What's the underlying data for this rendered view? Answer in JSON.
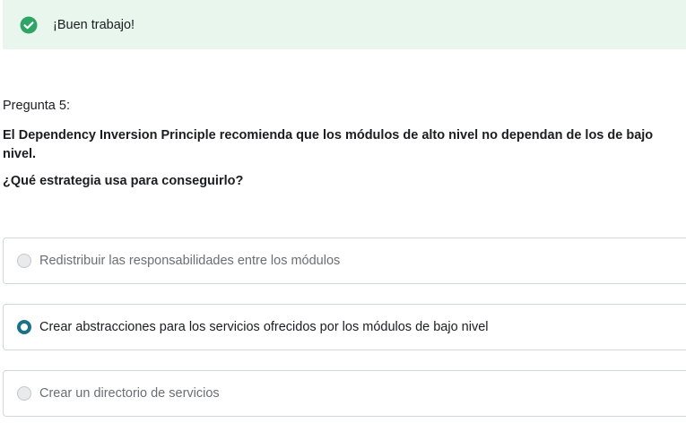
{
  "feedback": {
    "icon": "check-circle-icon",
    "color": "#2ea566",
    "background": "#e9f6ee",
    "message": "¡Buen trabajo!"
  },
  "question": {
    "number_label": "Pregunta 5:",
    "statement": "El Dependency Inversion Principle recomienda que los módulos de alto nivel no dependan de los de bajo nivel.",
    "prompt": "¿Qué estrategia usa para conseguirlo?"
  },
  "options": [
    {
      "label": "Redistribuir las responsabilidades entre los módulos",
      "selected": false
    },
    {
      "label": "Crear abstracciones para los servicios ofrecidos por los módulos de bajo nivel",
      "selected": true
    },
    {
      "label": "Crear un directorio de servicios",
      "selected": false
    }
  ],
  "colors": {
    "accent": "#1a7287",
    "border": "#d1d7dc",
    "success": "#2ea566"
  }
}
